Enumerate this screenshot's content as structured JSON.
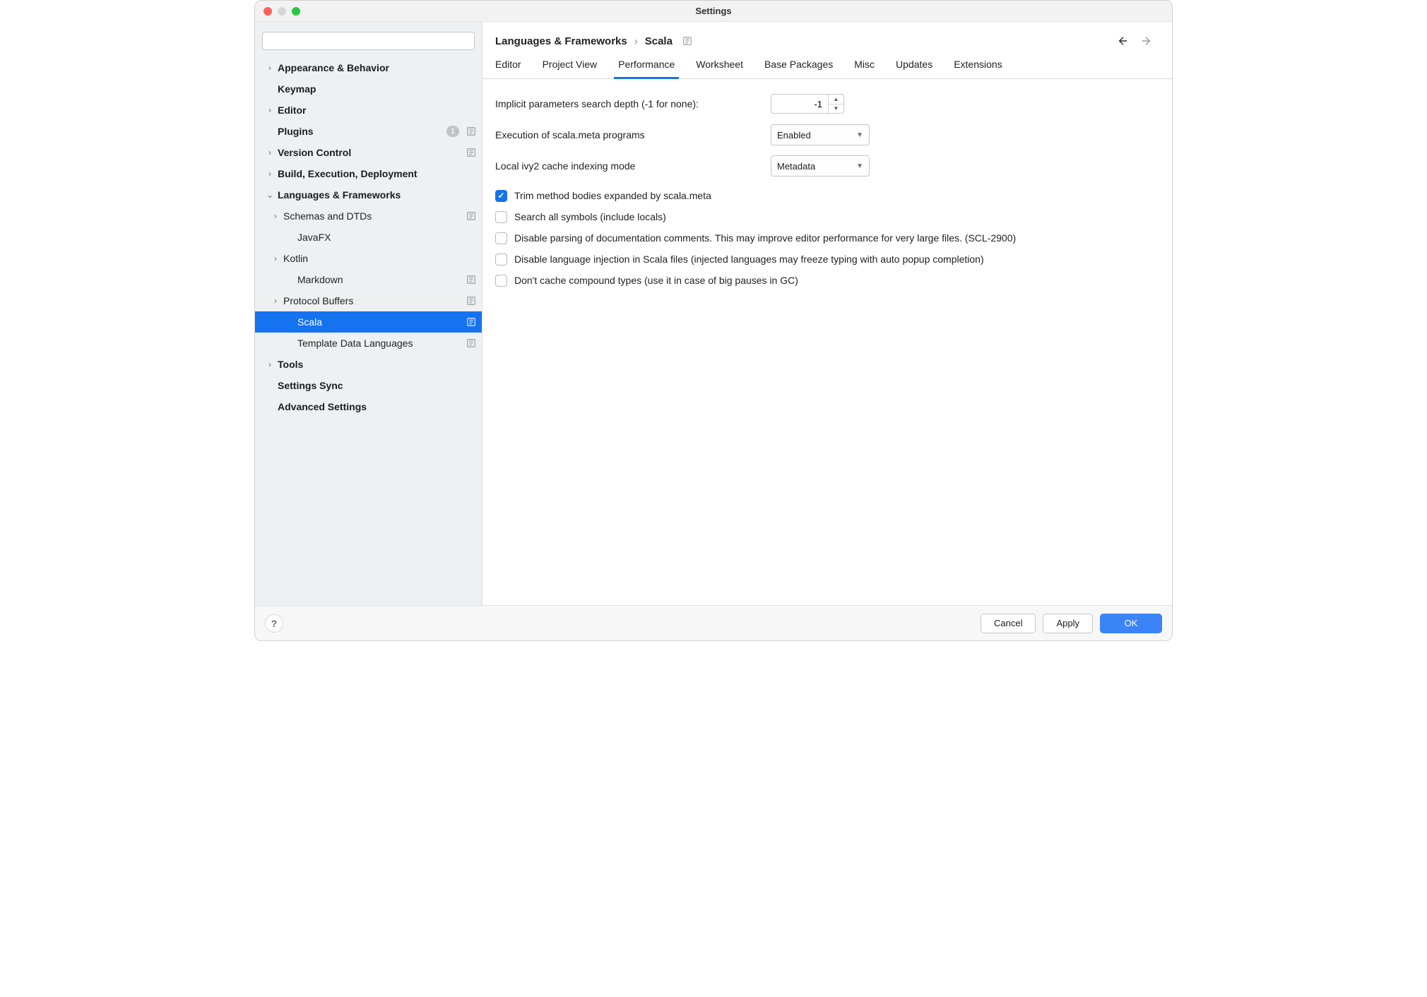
{
  "window": {
    "title": "Settings"
  },
  "search": {
    "placeholder": ""
  },
  "sidebar": {
    "items": [
      {
        "label": "Appearance & Behavior",
        "bold": true,
        "arrow": "right"
      },
      {
        "label": "Keymap",
        "bold": true,
        "arrow": "none"
      },
      {
        "label": "Editor",
        "bold": true,
        "arrow": "right"
      },
      {
        "label": "Plugins",
        "bold": true,
        "arrow": "none",
        "badge": "1",
        "proj": true
      },
      {
        "label": "Version Control",
        "bold": true,
        "arrow": "right",
        "proj": true
      },
      {
        "label": "Build, Execution, Deployment",
        "bold": true,
        "arrow": "right"
      },
      {
        "label": "Languages & Frameworks",
        "bold": true,
        "arrow": "down"
      },
      {
        "label": "Schemas and DTDs",
        "indent": 1,
        "arrow": "right",
        "proj": true
      },
      {
        "label": "JavaFX",
        "indent": 2,
        "arrow": "none"
      },
      {
        "label": "Kotlin",
        "indent": 1,
        "arrow": "right"
      },
      {
        "label": "Markdown",
        "indent": 2,
        "proj": true
      },
      {
        "label": "Protocol Buffers",
        "indent": 1,
        "arrow": "right",
        "proj": true
      },
      {
        "label": "Scala",
        "indent": 2,
        "selected": true,
        "proj": true
      },
      {
        "label": "Template Data Languages",
        "indent": 2,
        "proj": true
      },
      {
        "label": "Tools",
        "bold": true,
        "arrow": "right"
      },
      {
        "label": "Settings Sync",
        "bold": true,
        "arrow": "none"
      },
      {
        "label": "Advanced Settings",
        "bold": true,
        "arrow": "none"
      }
    ]
  },
  "breadcrumb": {
    "parent": "Languages & Frameworks",
    "current": "Scala"
  },
  "tabs": [
    {
      "label": "Editor"
    },
    {
      "label": "Project View"
    },
    {
      "label": "Performance",
      "active": true
    },
    {
      "label": "Worksheet"
    },
    {
      "label": "Base Packages"
    },
    {
      "label": "Misc"
    },
    {
      "label": "Updates"
    },
    {
      "label": "Extensions"
    }
  ],
  "form": {
    "implicit_depth_label": "Implicit parameters search depth (-1 for none):",
    "implicit_depth_value": "-1",
    "scala_meta_label": "Execution of scala.meta programs",
    "scala_meta_value": "Enabled",
    "ivy2_label": "Local ivy2 cache indexing mode",
    "ivy2_value": "Metadata",
    "checks": [
      {
        "label": "Trim method bodies expanded by scala.meta",
        "checked": true
      },
      {
        "label": "Search all symbols (include locals)",
        "checked": false
      },
      {
        "label": "Disable parsing of documentation comments. This may improve editor performance for very large files. (SCL-2900)",
        "checked": false
      },
      {
        "label": "Disable language injection in Scala files (injected languages may freeze typing with auto popup completion)",
        "checked": false
      },
      {
        "label": "Don't cache compound types (use it in case of big pauses in GC)",
        "checked": false
      }
    ]
  },
  "footer": {
    "cancel": "Cancel",
    "apply": "Apply",
    "ok": "OK"
  }
}
